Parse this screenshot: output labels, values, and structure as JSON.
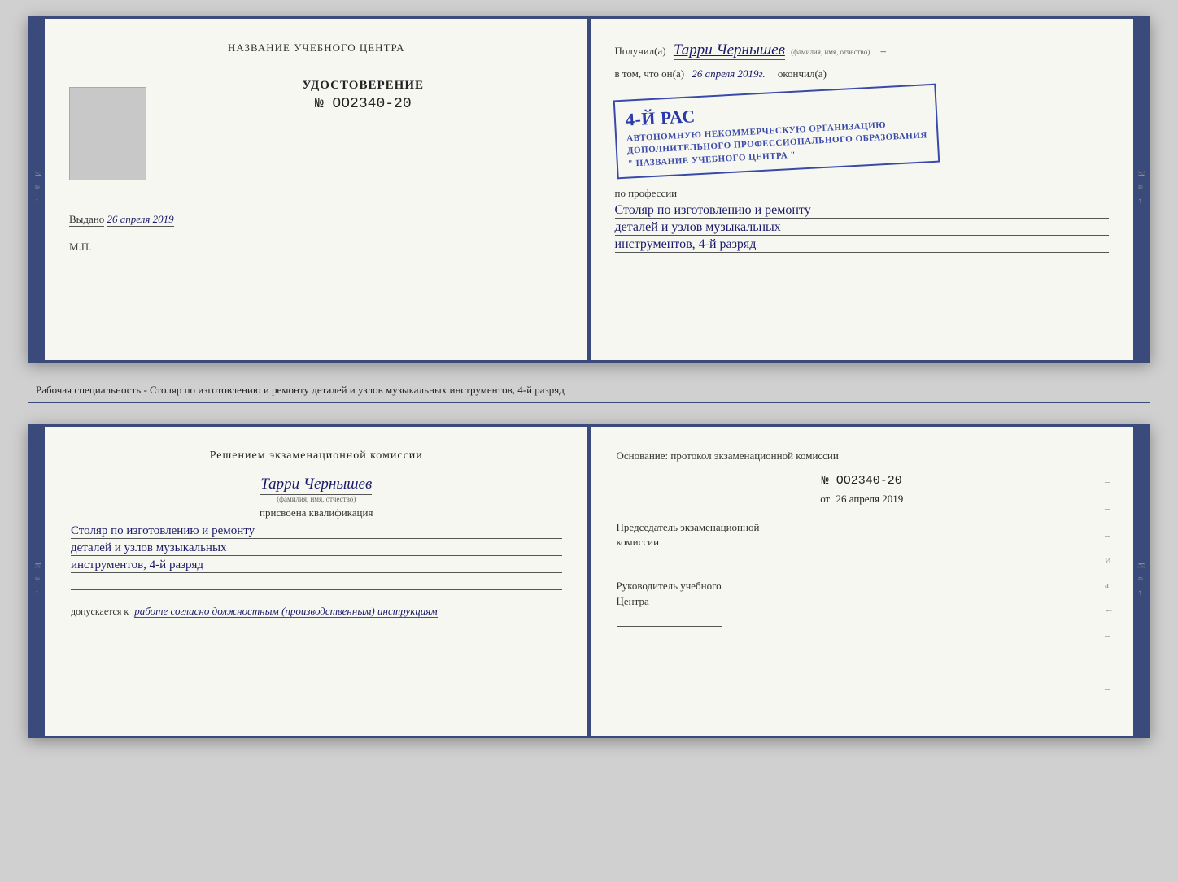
{
  "top_spread": {
    "left_page": {
      "center_title": "НАЗВАНИЕ УЧЕБНОГО ЦЕНТРА",
      "cert_label": "УДОСТОВЕРЕНИЕ",
      "cert_number": "№ OO2340-20",
      "issued_label": "Выдано",
      "issued_date": "26 апреля 2019",
      "mp_label": "М.П."
    },
    "right_page": {
      "received_label": "Получил(а)",
      "recipient_name": "Тарри Чернышев",
      "recipient_hint": "(фамилия, имя, отчество)",
      "tom_label": "в том, что он(а)",
      "date_value": "26 апреля 2019г.",
      "finished_label": "окончил(а)",
      "stamp_line1": "4-й рас",
      "stamp_org1": "АВТОНОМНУЮ НЕКОММЕРЧЕСКУЮ ОРГАНИЗАЦИЮ",
      "stamp_org2": "ДОПОЛНИТЕЛЬНОГО ПРОФЕССИОНАЛЬНОГО ОБРАЗОВАНИЯ",
      "stamp_org3": "\" НАЗВАНИЕ УЧЕБНОГО ЦЕНТРА \"",
      "profession_label": "по профессии",
      "profession_line1": "Столяр по изготовлению и ремонту",
      "profession_line2": "деталей и узлов музыкальных",
      "profession_line3": "инструментов, 4-й разряд"
    }
  },
  "caption": "Рабочая специальность - Столяр по изготовлению и ремонту деталей и узлов музыкальных инструментов, 4-й разряд",
  "bottom_spread": {
    "left_page": {
      "decision_title": "Решением  экзаменационной  комиссии",
      "person_name": "Тарри Чернышев",
      "person_hint": "(фамилия, имя, отчество)",
      "assigned_label": "присвоена квалификация",
      "qual_line1": "Столяр по изготовлению и ремонту",
      "qual_line2": "деталей и узлов музыкальных",
      "qual_line3": "инструментов, 4-й разряд",
      "допуск_prefix": "допускается к",
      "допуск_text": "работе согласно должностным (производственным) инструкциям"
    },
    "right_page": {
      "basis_label": "Основание: протокол экзаменационной комиссии",
      "protocol_number": "№  OO2340-20",
      "date_prefix": "от",
      "date_value": "26 апреля 2019",
      "chair_label1": "Председатель экзаменационной",
      "chair_label2": "комиссии",
      "head_label1": "Руководитель учебного",
      "head_label2": "Центра"
    }
  },
  "side_strip_chars": "И а ←"
}
